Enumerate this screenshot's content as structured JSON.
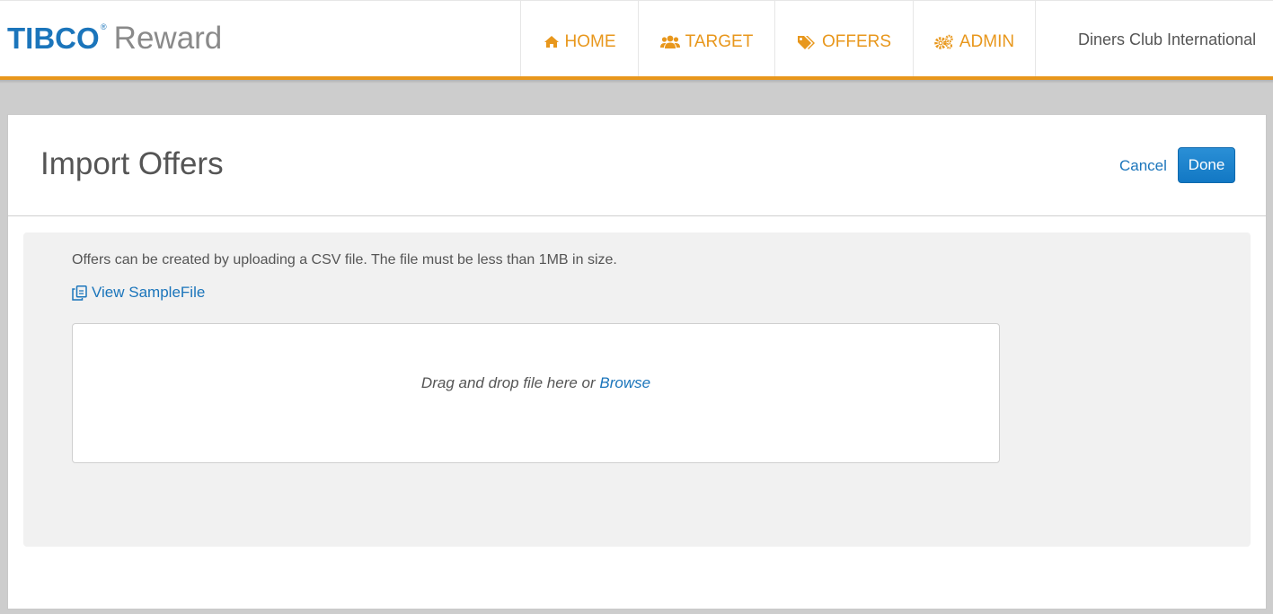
{
  "header": {
    "logo_brand": "TIBCO",
    "logo_registered": "®",
    "logo_product": "Reward",
    "nav": [
      {
        "label": "HOME",
        "icon": "home-icon"
      },
      {
        "label": "TARGET",
        "icon": "users-icon"
      },
      {
        "label": "OFFERS",
        "icon": "tags-icon"
      },
      {
        "label": "ADMIN",
        "icon": "cogs-icon"
      }
    ],
    "account_name": "Diners Club International"
  },
  "page": {
    "title": "Import Offers",
    "cancel_label": "Cancel",
    "done_label": "Done",
    "info_text": "Offers can be created by uploading a CSV file. The file must be less than 1MB in size.",
    "sample_link_label": "View SampleFile",
    "sample_link_icon": "copy-icon",
    "dropzone_text": "Drag and drop file here or ",
    "browse_label": "Browse"
  },
  "colors": {
    "accent_orange": "#e8971c",
    "link_blue": "#1b75bb",
    "primary_button": "#1278c4"
  }
}
